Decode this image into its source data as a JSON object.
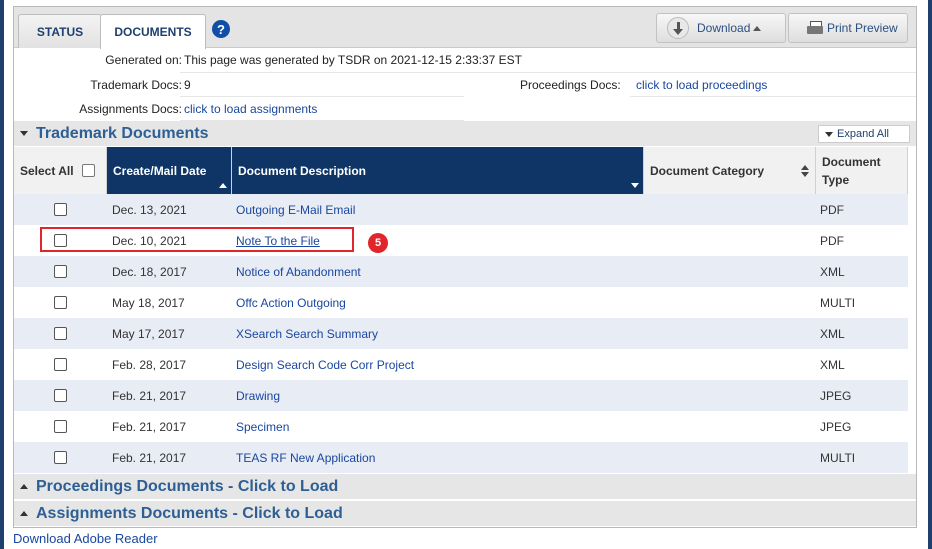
{
  "tabs": {
    "status": "STATUS",
    "documents": "DOCUMENTS",
    "help": "?"
  },
  "toolbar": {
    "download": "Download",
    "print": "Print Preview"
  },
  "info": {
    "generated_label": "Generated on:",
    "generated_value": "This page was generated by TSDR on 2021-12-15 2:33:37 EST",
    "trademark_docs_label": "Trademark Docs:",
    "trademark_docs_value": "9",
    "proceedings_docs_label": "Proceedings Docs:",
    "proceedings_docs_value": "click to load proceedings",
    "assignments_docs_label": "Assignments Docs:",
    "assignments_docs_value": "click to load assignments"
  },
  "sections": {
    "trademark": "Trademark Documents",
    "expand_all": "Expand All",
    "proceedings": "Proceedings Documents - Click to Load",
    "assignments": "Assignments Documents - Click to Load"
  },
  "table": {
    "headers": {
      "select_all": "Select All",
      "date": "Create/Mail Date",
      "description": "Document Description",
      "category": "Document Category",
      "type_line1": "Document",
      "type_line2": "Type"
    },
    "rows": [
      {
        "date": "Dec. 13, 2021",
        "description": "Outgoing E-Mail Email",
        "type": "PDF"
      },
      {
        "date": "Dec. 10, 2021",
        "description": "Note To the File",
        "type": "PDF"
      },
      {
        "date": "Dec. 18, 2017",
        "description": "Notice of Abandonment",
        "type": "XML"
      },
      {
        "date": "May 18, 2017",
        "description": "Offc Action Outgoing",
        "type": "MULTI"
      },
      {
        "date": "May 17, 2017",
        "description": "XSearch Search Summary",
        "type": "XML"
      },
      {
        "date": "Feb. 28, 2017",
        "description": "Design Search Code Corr Project",
        "type": "XML"
      },
      {
        "date": "Feb. 21, 2017",
        "description": "Drawing",
        "type": "JPEG"
      },
      {
        "date": "Feb. 21, 2017",
        "description": "Specimen",
        "type": "JPEG"
      },
      {
        "date": "Feb. 21, 2017",
        "description": "TEAS RF New Application",
        "type": "MULTI"
      }
    ]
  },
  "annotation": {
    "badge": "5"
  },
  "footer": {
    "adobe": "Download Adobe Reader"
  },
  "colors": {
    "header_navy": "#0e3566",
    "link_blue": "#1a47a0",
    "highlight_red": "#e0262b",
    "section_blue": "#2d5f95"
  }
}
